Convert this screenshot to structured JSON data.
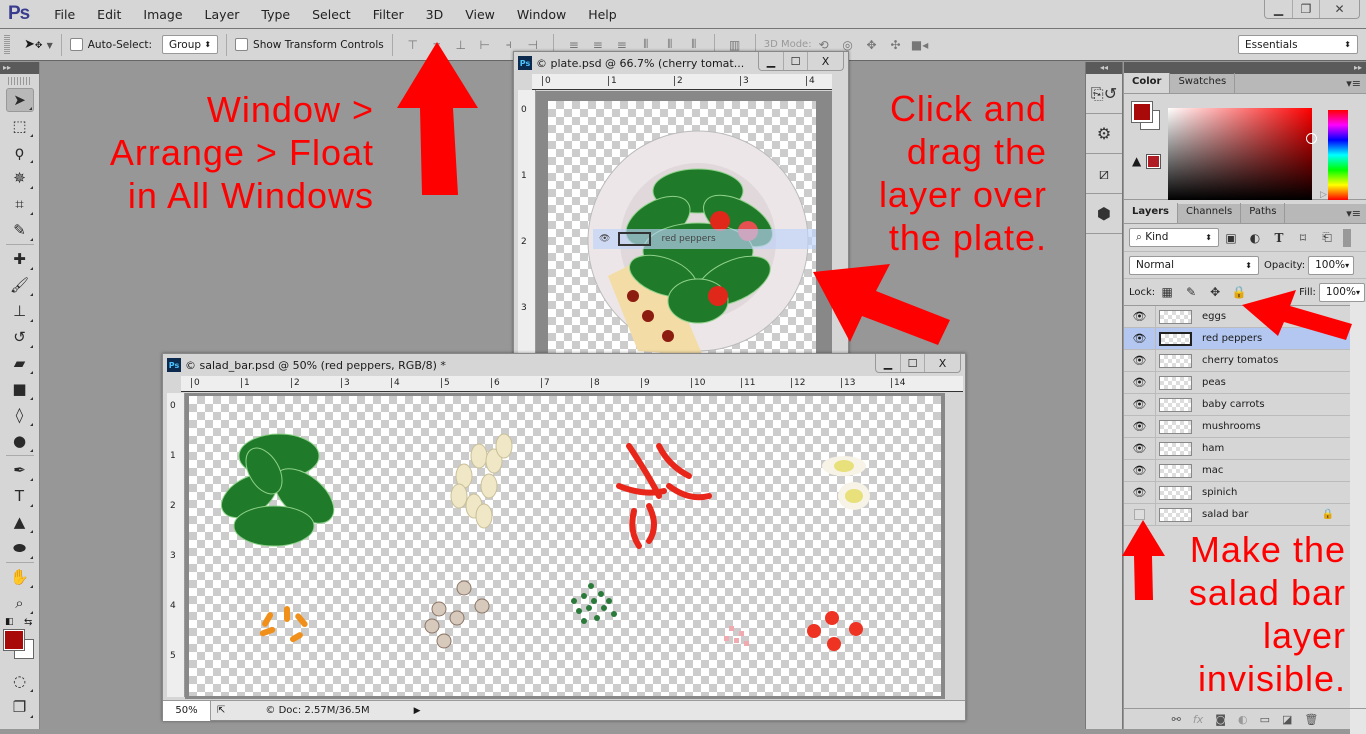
{
  "app": {
    "logo": "Ps"
  },
  "menu": [
    "File",
    "Edit",
    "Image",
    "Layer",
    "Type",
    "Select",
    "Filter",
    "3D",
    "View",
    "Window",
    "Help"
  ],
  "window_controls": {
    "minimize": "▁",
    "restore": "❐",
    "close": "✕"
  },
  "options_bar": {
    "auto_select_label": "Auto-Select:",
    "auto_select_value": "Group",
    "show_transform_label": "Show Transform Controls",
    "mode_3d_label": "3D Mode:",
    "workspace": "Essentials"
  },
  "tools": [
    {
      "name": "move-tool",
      "glyph": "➤",
      "active": true
    },
    {
      "name": "marquee-tool",
      "glyph": "⬚"
    },
    {
      "name": "lasso-tool",
      "glyph": "ϙ"
    },
    {
      "name": "magic-wand-tool",
      "glyph": "✵"
    },
    {
      "name": "crop-tool",
      "glyph": "⌗"
    },
    {
      "name": "eyedropper-tool",
      "glyph": "✎"
    },
    {
      "name": "healing-brush-tool",
      "glyph": "✚"
    },
    {
      "name": "brush-tool",
      "glyph": "🖌"
    },
    {
      "name": "clone-stamp-tool",
      "glyph": "⊥"
    },
    {
      "name": "history-brush-tool",
      "glyph": "↺"
    },
    {
      "name": "eraser-tool",
      "glyph": "▰"
    },
    {
      "name": "gradient-tool",
      "glyph": "■"
    },
    {
      "name": "blur-tool",
      "glyph": "◊"
    },
    {
      "name": "dodge-tool",
      "glyph": "●"
    },
    {
      "name": "pen-tool",
      "glyph": "✒"
    },
    {
      "name": "type-tool",
      "glyph": "T"
    },
    {
      "name": "path-selection-tool",
      "glyph": "▲"
    },
    {
      "name": "ellipse-tool",
      "glyph": "⬬"
    },
    {
      "name": "hand-tool",
      "glyph": "✋"
    },
    {
      "name": "zoom-tool",
      "glyph": "⌕"
    }
  ],
  "colors": {
    "foreground": "#a80a0a",
    "background": "#ffffff",
    "gamut_swatch": "#b01c24",
    "accent_annotation": "#ff0000"
  },
  "color_panel": {
    "tabs": [
      "Color",
      "Swatches"
    ],
    "active": "Color"
  },
  "layers_panel": {
    "tabs": [
      "Layers",
      "Channels",
      "Paths"
    ],
    "active": "Layers",
    "filter_kind": "Kind",
    "blend_mode": "Normal",
    "opacity_label": "Opacity:",
    "opacity": "100%",
    "lock_label": "Lock:",
    "fill_label": "Fill:",
    "fill": "100%",
    "layers": [
      {
        "name": "eggs",
        "visible": true,
        "selected": false,
        "locked": false
      },
      {
        "name": "red peppers",
        "visible": true,
        "selected": true,
        "locked": false
      },
      {
        "name": "cherry tomatos",
        "visible": true,
        "selected": false,
        "locked": false
      },
      {
        "name": "peas",
        "visible": true,
        "selected": false,
        "locked": false
      },
      {
        "name": "baby carrots",
        "visible": true,
        "selected": false,
        "locked": false
      },
      {
        "name": "mushrooms",
        "visible": true,
        "selected": false,
        "locked": false
      },
      {
        "name": "ham",
        "visible": true,
        "selected": false,
        "locked": false
      },
      {
        "name": "mac",
        "visible": true,
        "selected": false,
        "locked": false
      },
      {
        "name": "spinich",
        "visible": true,
        "selected": false,
        "locked": false
      },
      {
        "name": "salad bar",
        "visible": false,
        "selected": false,
        "locked": true
      }
    ],
    "footer_icons": [
      "link-icon",
      "fx-icon",
      "mask-icon",
      "adjustment-icon",
      "folder-icon",
      "new-layer-icon",
      "trash-icon"
    ]
  },
  "plate_doc": {
    "title": "© plate.psd @ 66.7% (cherry tomat...",
    "ruler_h": [
      "0",
      "1",
      "2",
      "3",
      "4"
    ],
    "ruler_v": [
      "0",
      "1",
      "2",
      "3"
    ],
    "drag_ghost_label": "red peppers"
  },
  "salad_doc": {
    "title": "© salad_bar.psd @ 50% (red peppers, RGB/8) *",
    "ruler_h": [
      "0",
      "1",
      "2",
      "3",
      "4",
      "5",
      "6",
      "7",
      "8",
      "9",
      "10",
      "11",
      "12",
      "13",
      "14"
    ],
    "ruler_v": [
      "0",
      "1",
      "2",
      "3",
      "4",
      "5"
    ],
    "zoom": "50%",
    "doc_info": "© Doc: 2.57M/36.5M"
  },
  "annotations": {
    "left": [
      "Window >",
      "Arrange > Float",
      "in All Windows"
    ],
    "right": [
      "Click and",
      "drag the",
      "layer over",
      "the plate."
    ],
    "bottom_right": [
      "Make the",
      "salad bar",
      "layer",
      "invisible."
    ]
  }
}
